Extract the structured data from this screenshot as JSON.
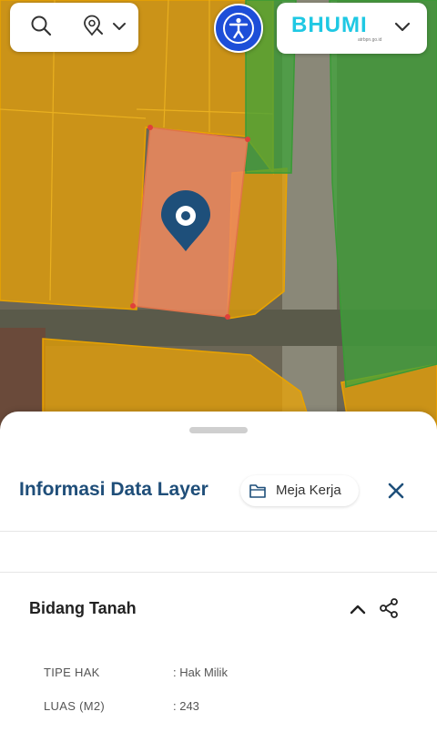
{
  "map": {
    "colors": {
      "parcel_orange": "#f0a500",
      "parcel_green": "#3ea33a",
      "selected_parcel": "#f08a5d",
      "marker": "#1e4f7a"
    },
    "icons": [
      "search-icon",
      "location-search-icon",
      "chevron-down-icon",
      "accessibility-icon",
      "map-pin-icon"
    ]
  },
  "brand": {
    "logo_text": "BHUMI",
    "subtitle": "atrbpn.go.id"
  },
  "panel": {
    "title": "Informasi Data Layer",
    "workspace_button": "Meja Kerja",
    "close_icon": "close-icon",
    "section_title": "Bidang Tanah",
    "rows": [
      {
        "label": "TIPE HAK",
        "value": ": Hak Milik"
      },
      {
        "label": "LUAS (M2)",
        "value": ": 243"
      }
    ]
  }
}
